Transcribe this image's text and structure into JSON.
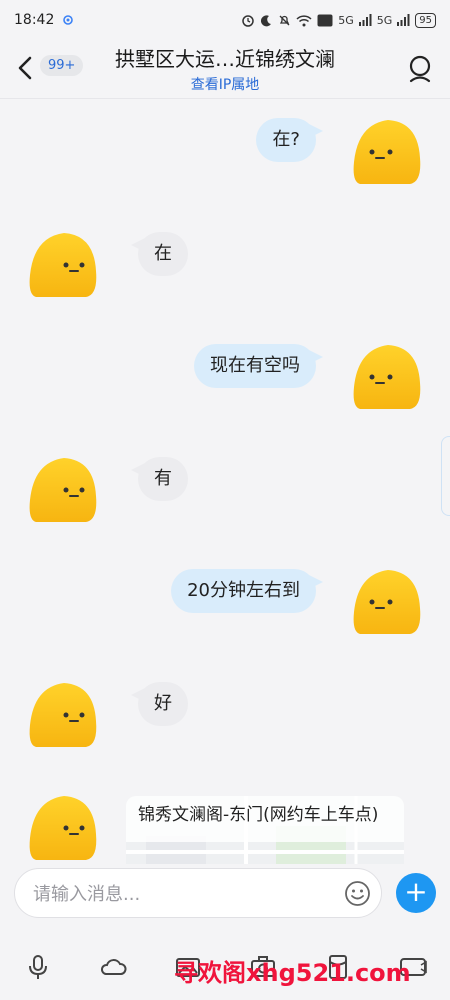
{
  "status_bar": {
    "time": "18:42",
    "network_left": "5G",
    "network_right": "5G",
    "battery": "95"
  },
  "header": {
    "badge": "99+",
    "title": "拱墅区大运…近锦绣文澜",
    "subtitle": "查看IP属地"
  },
  "messages": [
    {
      "side": "out",
      "text": "在?"
    },
    {
      "side": "in",
      "text": "在"
    },
    {
      "side": "out",
      "text": "现在有空吗"
    },
    {
      "side": "in",
      "text": "有"
    },
    {
      "side": "out",
      "text": "20分钟左右到"
    },
    {
      "side": "in",
      "text": "好"
    }
  ],
  "location_card": {
    "title": "锦秀文澜阁-东门(网约车上车点)"
  },
  "composer": {
    "placeholder": "请输入消息..."
  },
  "watermark": "寻欢阁xhg521.com",
  "colors": {
    "accent_blue": "#1e97f2",
    "outgoing_bubble": "#d9ecfb",
    "incoming_bubble": "#ececef",
    "avatar_yellow": "#fcc419",
    "watermark_red": "#f0143c"
  },
  "icons": [
    "back-arrow-icon",
    "profile-icon",
    "emoji-icon",
    "plus-icon",
    "microphone-icon",
    "cloud-icon",
    "image-icon",
    "camera-icon",
    "red-packet-icon",
    "gif-icon"
  ]
}
